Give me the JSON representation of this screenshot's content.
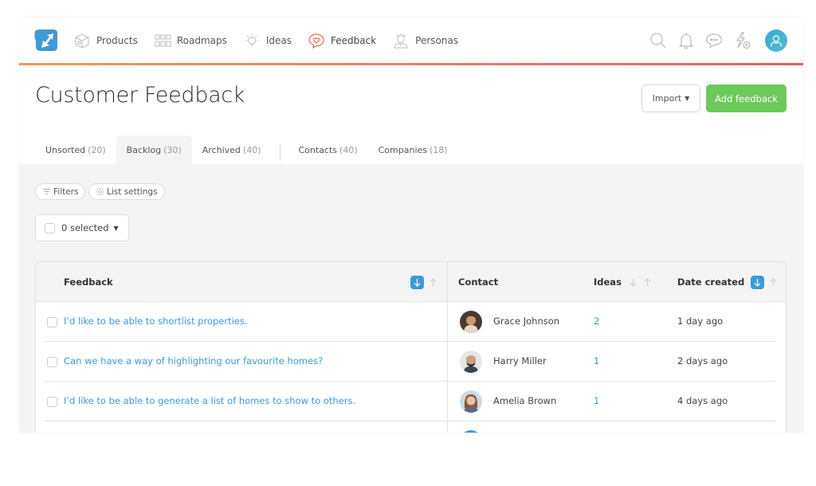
{
  "nav": {
    "items": [
      {
        "label": "Products",
        "icon": "box-icon",
        "active": false
      },
      {
        "label": "Roadmaps",
        "icon": "grid-icon",
        "active": false
      },
      {
        "label": "Ideas",
        "icon": "lightbulb-icon",
        "active": false
      },
      {
        "label": "Feedback",
        "icon": "heart-speech-bubble-icon",
        "active": true
      },
      {
        "label": "Personas",
        "icon": "persona-icon",
        "active": false
      }
    ],
    "right_icons": [
      "search-icon",
      "bell-icon",
      "chat-bubble-icon",
      "lightning-plus-icon",
      "user-avatar-icon"
    ]
  },
  "colors": {
    "brand_blue": "#3d9ad7",
    "accent_green": "#6cc95a",
    "feedback_orange": "#e8674f",
    "gradient_start": "#ec9a5c",
    "gradient_end": "#e35d64"
  },
  "header": {
    "title": "Customer Feedback",
    "import_label": "Import",
    "add_label": "Add feedback"
  },
  "tabs": [
    {
      "label": "Unsorted",
      "count": "(20)",
      "active": false
    },
    {
      "label": "Backlog",
      "count": "(30)",
      "active": true
    },
    {
      "label": "Archived",
      "count": "(40)",
      "active": false
    },
    {
      "label": "Contacts",
      "count": "(40)",
      "active": false
    },
    {
      "label": "Companies",
      "count": "(18)",
      "active": false
    }
  ],
  "toolbar": {
    "filters_label": "Filters",
    "list_settings_label": "List settings",
    "selected_label": "0 selected"
  },
  "table": {
    "columns": {
      "feedback": "Feedback",
      "contact": "Contact",
      "ideas": "Ideas",
      "date_created": "Date created"
    },
    "rows": [
      {
        "feedback": "I’d like to be able to shortlist properties.",
        "contact": "Grace Johnson",
        "ideas": "2",
        "date": "1 day ago"
      },
      {
        "feedback": "Can we have a way of highlighting our favourite homes?",
        "contact": "Harry Miller",
        "ideas": "1",
        "date": "2 days ago"
      },
      {
        "feedback": "I’d like to be able to generate a list of homes to show to others.",
        "contact": "Amelia Brown",
        "ideas": "1",
        "date": "4 days ago"
      }
    ]
  }
}
